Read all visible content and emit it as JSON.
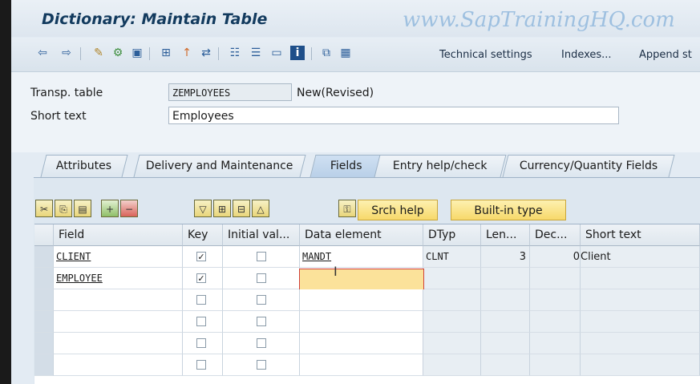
{
  "window": {
    "title": "Dictionary: Maintain Table",
    "watermark": "www.SapTrainingHQ.com"
  },
  "toolbar": {
    "icons": [
      "back-icon",
      "forward-icon",
      "edit-icon",
      "activate-icon",
      "where-used-icon",
      "object-list-icon",
      "display-icon",
      "navigate-icon",
      "hierarchy-icon",
      "layout-icon",
      "image-icon",
      "info-icon",
      "indexes-icon",
      "table-icon"
    ],
    "technical_settings": "Technical settings",
    "indexes": "Indexes...",
    "append": "Append st"
  },
  "header": {
    "table_label": "Transp. table",
    "table_value": "ZEMPLOYEES",
    "table_status": "New(Revised)",
    "short_text_label": "Short text",
    "short_text_value": "Employees"
  },
  "tabs": [
    {
      "label": "Attributes"
    },
    {
      "label": "Delivery and Maintenance"
    },
    {
      "label": "Fields"
    },
    {
      "label": "Entry help/check"
    },
    {
      "label": "Currency/Quantity Fields"
    }
  ],
  "buttons": {
    "search_help": "Srch help",
    "builtin_type": "Built-in type"
  },
  "grid": {
    "columns": [
      "Field",
      "Key",
      "Initial val...",
      "Data element",
      "DTyp",
      "Len...",
      "Dec...",
      "Short text"
    ],
    "rows": [
      {
        "field": "CLIENT",
        "key": true,
        "initial": false,
        "data_element": "MANDT",
        "dtyp": "CLNT",
        "len": "3",
        "dec": "0",
        "short_text": "Client"
      },
      {
        "field": "EMPLOYEE",
        "key": true,
        "initial": false,
        "data_element": "",
        "dtyp": "",
        "len": "",
        "dec": "",
        "short_text": ""
      }
    ]
  }
}
